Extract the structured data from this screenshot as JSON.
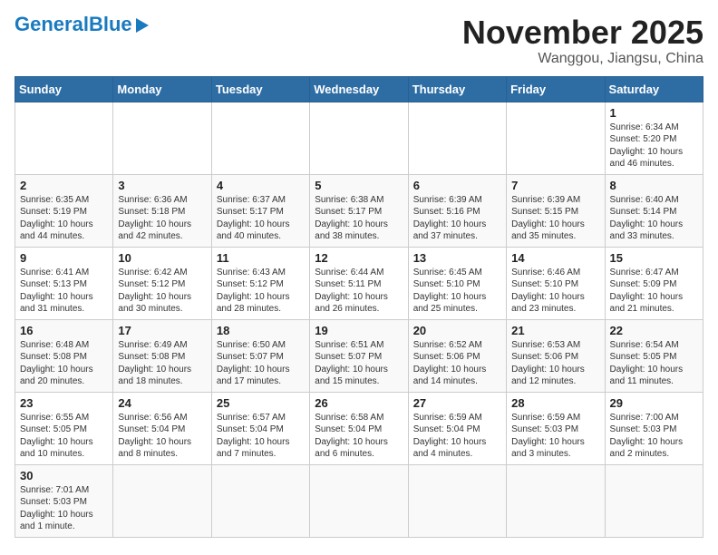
{
  "header": {
    "logo_general": "General",
    "logo_blue": "Blue",
    "month_title": "November 2025",
    "location": "Wanggou, Jiangsu, China"
  },
  "days_of_week": [
    "Sunday",
    "Monday",
    "Tuesday",
    "Wednesday",
    "Thursday",
    "Friday",
    "Saturday"
  ],
  "weeks": [
    [
      {
        "day": "",
        "info": ""
      },
      {
        "day": "",
        "info": ""
      },
      {
        "day": "",
        "info": ""
      },
      {
        "day": "",
        "info": ""
      },
      {
        "day": "",
        "info": ""
      },
      {
        "day": "",
        "info": ""
      },
      {
        "day": "1",
        "info": "Sunrise: 6:34 AM\nSunset: 5:20 PM\nDaylight: 10 hours and 46 minutes."
      }
    ],
    [
      {
        "day": "2",
        "info": "Sunrise: 6:35 AM\nSunset: 5:19 PM\nDaylight: 10 hours and 44 minutes."
      },
      {
        "day": "3",
        "info": "Sunrise: 6:36 AM\nSunset: 5:18 PM\nDaylight: 10 hours and 42 minutes."
      },
      {
        "day": "4",
        "info": "Sunrise: 6:37 AM\nSunset: 5:17 PM\nDaylight: 10 hours and 40 minutes."
      },
      {
        "day": "5",
        "info": "Sunrise: 6:38 AM\nSunset: 5:17 PM\nDaylight: 10 hours and 38 minutes."
      },
      {
        "day": "6",
        "info": "Sunrise: 6:39 AM\nSunset: 5:16 PM\nDaylight: 10 hours and 37 minutes."
      },
      {
        "day": "7",
        "info": "Sunrise: 6:39 AM\nSunset: 5:15 PM\nDaylight: 10 hours and 35 minutes."
      },
      {
        "day": "8",
        "info": "Sunrise: 6:40 AM\nSunset: 5:14 PM\nDaylight: 10 hours and 33 minutes."
      }
    ],
    [
      {
        "day": "9",
        "info": "Sunrise: 6:41 AM\nSunset: 5:13 PM\nDaylight: 10 hours and 31 minutes."
      },
      {
        "day": "10",
        "info": "Sunrise: 6:42 AM\nSunset: 5:12 PM\nDaylight: 10 hours and 30 minutes."
      },
      {
        "day": "11",
        "info": "Sunrise: 6:43 AM\nSunset: 5:12 PM\nDaylight: 10 hours and 28 minutes."
      },
      {
        "day": "12",
        "info": "Sunrise: 6:44 AM\nSunset: 5:11 PM\nDaylight: 10 hours and 26 minutes."
      },
      {
        "day": "13",
        "info": "Sunrise: 6:45 AM\nSunset: 5:10 PM\nDaylight: 10 hours and 25 minutes."
      },
      {
        "day": "14",
        "info": "Sunrise: 6:46 AM\nSunset: 5:10 PM\nDaylight: 10 hours and 23 minutes."
      },
      {
        "day": "15",
        "info": "Sunrise: 6:47 AM\nSunset: 5:09 PM\nDaylight: 10 hours and 21 minutes."
      }
    ],
    [
      {
        "day": "16",
        "info": "Sunrise: 6:48 AM\nSunset: 5:08 PM\nDaylight: 10 hours and 20 minutes."
      },
      {
        "day": "17",
        "info": "Sunrise: 6:49 AM\nSunset: 5:08 PM\nDaylight: 10 hours and 18 minutes."
      },
      {
        "day": "18",
        "info": "Sunrise: 6:50 AM\nSunset: 5:07 PM\nDaylight: 10 hours and 17 minutes."
      },
      {
        "day": "19",
        "info": "Sunrise: 6:51 AM\nSunset: 5:07 PM\nDaylight: 10 hours and 15 minutes."
      },
      {
        "day": "20",
        "info": "Sunrise: 6:52 AM\nSunset: 5:06 PM\nDaylight: 10 hours and 14 minutes."
      },
      {
        "day": "21",
        "info": "Sunrise: 6:53 AM\nSunset: 5:06 PM\nDaylight: 10 hours and 12 minutes."
      },
      {
        "day": "22",
        "info": "Sunrise: 6:54 AM\nSunset: 5:05 PM\nDaylight: 10 hours and 11 minutes."
      }
    ],
    [
      {
        "day": "23",
        "info": "Sunrise: 6:55 AM\nSunset: 5:05 PM\nDaylight: 10 hours and 10 minutes."
      },
      {
        "day": "24",
        "info": "Sunrise: 6:56 AM\nSunset: 5:04 PM\nDaylight: 10 hours and 8 minutes."
      },
      {
        "day": "25",
        "info": "Sunrise: 6:57 AM\nSunset: 5:04 PM\nDaylight: 10 hours and 7 minutes."
      },
      {
        "day": "26",
        "info": "Sunrise: 6:58 AM\nSunset: 5:04 PM\nDaylight: 10 hours and 6 minutes."
      },
      {
        "day": "27",
        "info": "Sunrise: 6:59 AM\nSunset: 5:04 PM\nDaylight: 10 hours and 4 minutes."
      },
      {
        "day": "28",
        "info": "Sunrise: 6:59 AM\nSunset: 5:03 PM\nDaylight: 10 hours and 3 minutes."
      },
      {
        "day": "29",
        "info": "Sunrise: 7:00 AM\nSunset: 5:03 PM\nDaylight: 10 hours and 2 minutes."
      }
    ],
    [
      {
        "day": "30",
        "info": "Sunrise: 7:01 AM\nSunset: 5:03 PM\nDaylight: 10 hours and 1 minute."
      },
      {
        "day": "",
        "info": ""
      },
      {
        "day": "",
        "info": ""
      },
      {
        "day": "",
        "info": ""
      },
      {
        "day": "",
        "info": ""
      },
      {
        "day": "",
        "info": ""
      },
      {
        "day": "",
        "info": ""
      }
    ]
  ]
}
